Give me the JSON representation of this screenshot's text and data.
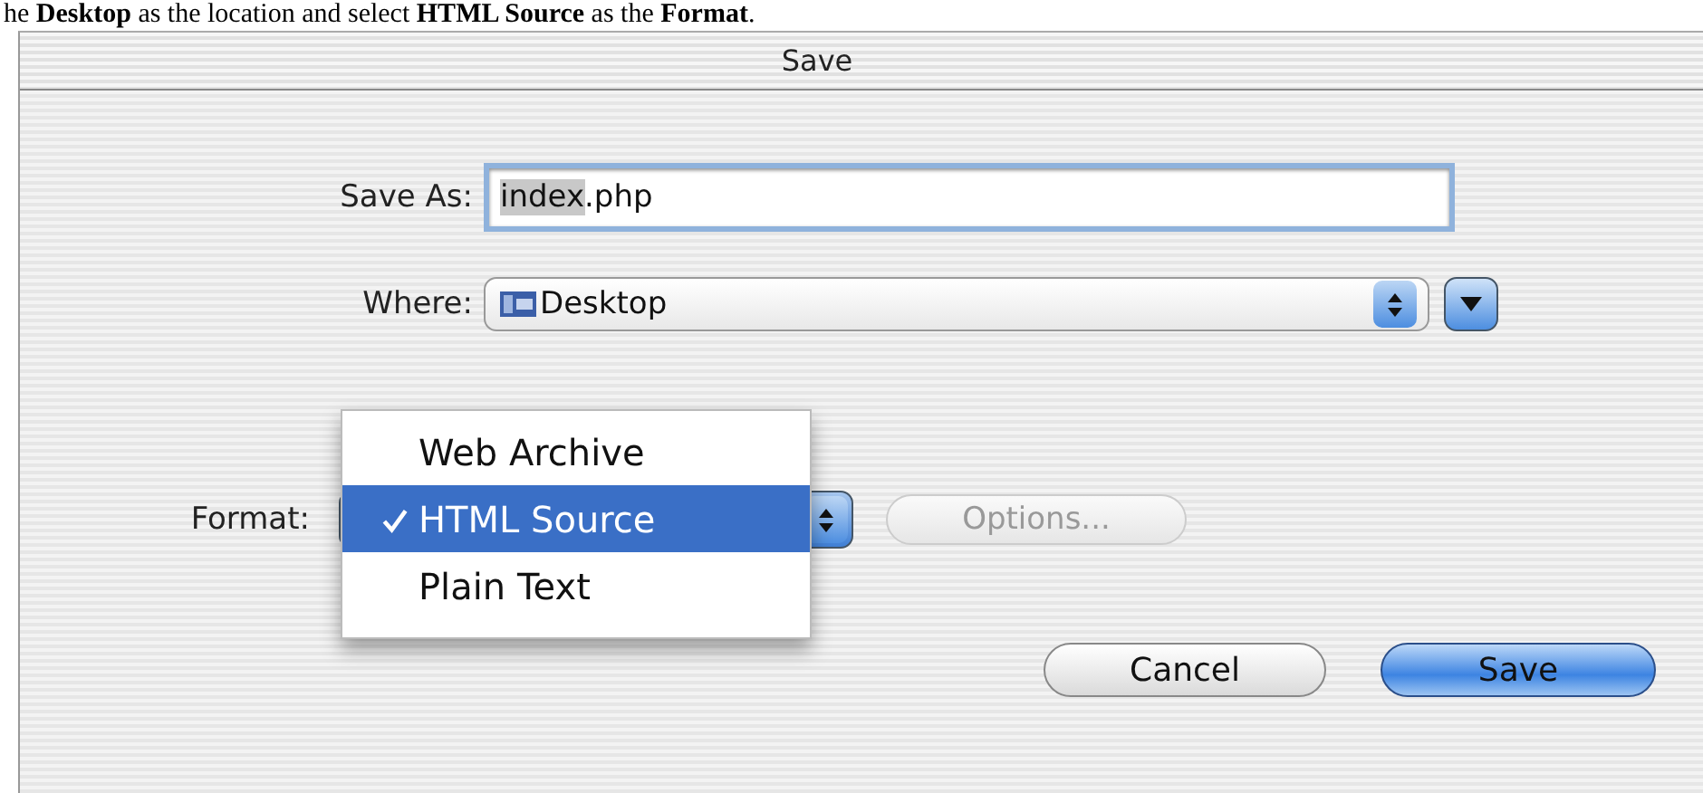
{
  "caption": "he **Desktop** as the location and select **HTML Source** as the **Format**.",
  "window": {
    "title": "Save"
  },
  "save_as": {
    "label": "Save As:",
    "value_parts": [
      {
        "text": "index",
        "selected": true
      },
      {
        "text": ".php",
        "selected": false
      }
    ]
  },
  "where": {
    "label": "Where:",
    "value": "Desktop",
    "expanded": false
  },
  "format": {
    "label": "Format:",
    "open": true,
    "menu": [
      {
        "label": "Web Archive",
        "selected": false
      },
      {
        "label": "HTML Source",
        "selected": true
      },
      {
        "label": "Plain Text",
        "selected": false
      }
    ],
    "options_button": {
      "label": "Options...",
      "disabled": true
    }
  },
  "buttons": [
    {
      "label": "Cancel",
      "kind": "normal"
    },
    {
      "label": "Save",
      "kind": "default"
    }
  ]
}
